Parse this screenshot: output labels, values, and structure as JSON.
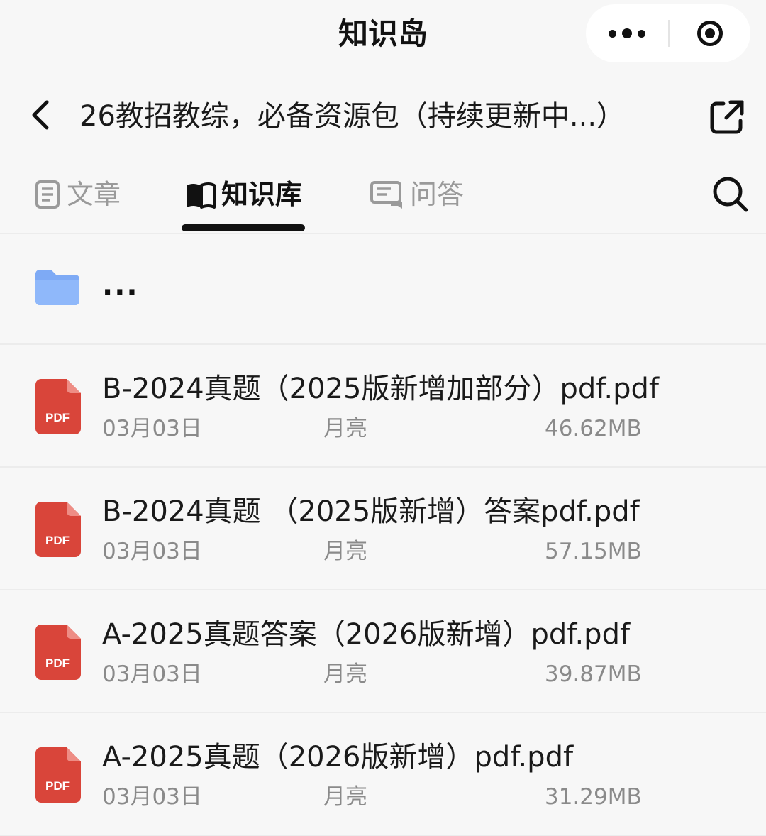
{
  "app": {
    "title": "知识岛"
  },
  "header": {
    "title": "26教招教综，必备资源包（持续更新中...）"
  },
  "tabs": [
    {
      "label": "文章",
      "icon": "article-icon",
      "active": false
    },
    {
      "label": "知识库",
      "icon": "book-icon",
      "active": true
    },
    {
      "label": "问答",
      "icon": "qa-icon",
      "active": false
    }
  ],
  "folder": {
    "name": "...",
    "icon": "folder-icon",
    "color": "#7eaaf5"
  },
  "files": [
    {
      "name": "B-2024真题（2025版新增加部分）pdf.pdf",
      "date": "03月03日",
      "owner": "月亮",
      "size": "46.62MB",
      "icon": "pdf-icon",
      "icon_label": "PDF"
    },
    {
      "name": "B-2024真题 （2025版新增）答案pdf.pdf",
      "date": "03月03日",
      "owner": "月亮",
      "size": "57.15MB",
      "icon": "pdf-icon",
      "icon_label": "PDF"
    },
    {
      "name": "A-2025真题答案（2026版新增）pdf.pdf",
      "date": "03月03日",
      "owner": "月亮",
      "size": "39.87MB",
      "icon": "pdf-icon",
      "icon_label": "PDF"
    },
    {
      "name": "A-2025真题（2026版新增）pdf.pdf",
      "date": "03月03日",
      "owner": "月亮",
      "size": "31.29MB",
      "icon": "pdf-icon",
      "icon_label": "PDF"
    }
  ],
  "colors": {
    "background": "#f7f7f7",
    "pdf_red": "#d9453a",
    "muted_text": "#8a8a8a",
    "inactive_tab": "#9a9a9a"
  }
}
